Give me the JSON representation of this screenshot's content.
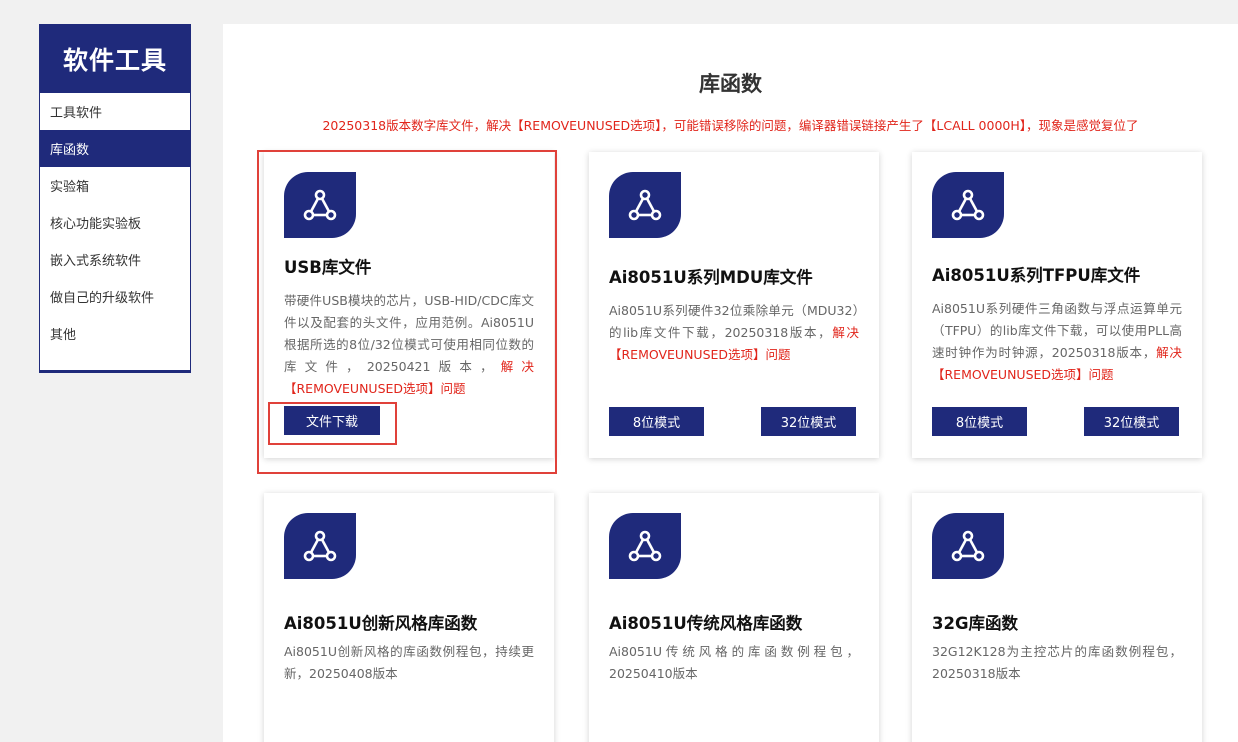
{
  "sidebar": {
    "title": "软件工具",
    "items": [
      {
        "label": "工具软件",
        "active": false
      },
      {
        "label": "库函数",
        "active": true
      },
      {
        "label": "实验箱",
        "active": false
      },
      {
        "label": "核心功能实验板",
        "active": false
      },
      {
        "label": "嵌入式系统软件",
        "active": false
      },
      {
        "label": "做自己的升级软件",
        "active": false
      },
      {
        "label": "其他",
        "active": false
      }
    ]
  },
  "main": {
    "title": "库函数",
    "notice": "20250318版本数字库文件，解决【REMOVEUNUSED选项】，可能错误移除的问题，编译器错误链接产生了【LCALL  0000H】，现象是感觉复位了"
  },
  "cards": [
    {
      "title": "USB库文件",
      "desc": "带硬件USB模块的芯片，USB-HID/CDC库文件以及配套的头文件，应用范例。Ai8051U根据所选的8位/32位模式可使用相同位数的库文件，20250421版本，",
      "desc_highlight": "解决【REMOVEUNUSED选项】问题",
      "buttons": [
        "文件下载"
      ]
    },
    {
      "title": "Ai8051U系列MDU库文件",
      "desc": "Ai8051U系列硬件32位乘除单元（MDU32）的lib库文件下载，20250318版本，",
      "desc_highlight": "解决【REMOVEUNUSED选项】问题",
      "buttons": [
        "8位模式",
        "32位模式"
      ]
    },
    {
      "title": "Ai8051U系列TFPU库文件",
      "desc": "Ai8051U系列硬件三角函数与浮点运算单元（TFPU）的lib库文件下载，可以使用PLL高速时钟作为时钟源，20250318版本，",
      "desc_highlight": "解决【REMOVEUNUSED选项】问题",
      "buttons": [
        "8位模式",
        "32位模式"
      ]
    },
    {
      "title": "Ai8051U创新风格库函数",
      "desc": "Ai8051U创新风格的库函数例程包，持续更新，20250408版本",
      "desc_highlight": "",
      "buttons": []
    },
    {
      "title": "Ai8051U传统风格库函数",
      "desc": "Ai8051U传统风格的库函数例程包，20250410版本",
      "desc_highlight": "",
      "buttons": []
    },
    {
      "title": "32G库函数",
      "desc": "32G12K128为主控芯片的库函数例程包，20250318版本",
      "desc_highlight": "",
      "buttons": []
    }
  ],
  "colors": {
    "brand": "#1f2a7b",
    "highlight": "#e1251b",
    "annotation_box": "#e0413a"
  },
  "icons": {
    "card_icon": "share-network-icon"
  }
}
